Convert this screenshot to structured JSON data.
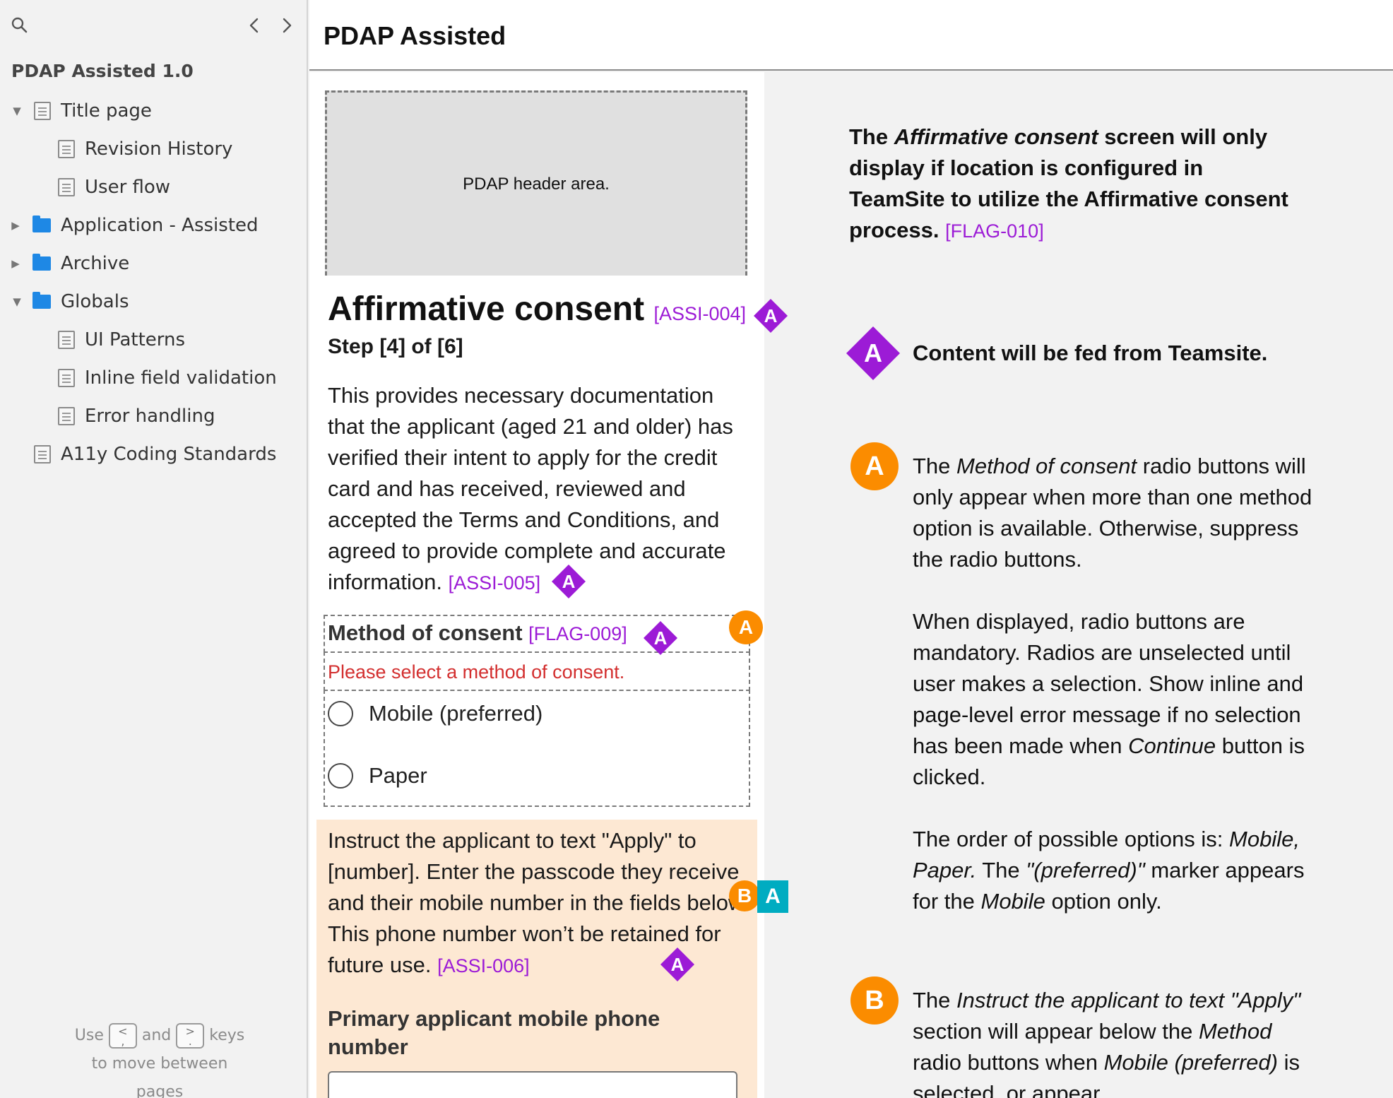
{
  "sidebar": {
    "project_title": "PDAP Assisted 1.0",
    "items": [
      {
        "label": "Title page",
        "type": "doc",
        "level": 0,
        "expanded": true
      },
      {
        "label": "Revision History",
        "type": "doc",
        "level": 1
      },
      {
        "label": "User flow",
        "type": "doc",
        "level": 1
      },
      {
        "label": "Application - Assisted",
        "type": "folder",
        "level": 0,
        "expanded": false
      },
      {
        "label": "Archive",
        "type": "folder",
        "level": 0,
        "expanded": false
      },
      {
        "label": "Globals",
        "type": "folder",
        "level": 0,
        "expanded": true
      },
      {
        "label": "UI Patterns",
        "type": "doc",
        "level": 1
      },
      {
        "label": "Inline field validation",
        "type": "doc",
        "level": 1
      },
      {
        "label": "Error handling",
        "type": "doc",
        "level": 1
      },
      {
        "label": "A11y Coding Standards",
        "type": "doc",
        "level": 0
      }
    ],
    "hint": {
      "use": "Use",
      "key_prev": "<",
      "and": "and",
      "key_next": ">",
      "keys": "keys",
      "line2": "to move between pages"
    }
  },
  "page": {
    "title": "PDAP Assisted"
  },
  "wireframe": {
    "header_area": "PDAP header area.",
    "heading": "Affirmative consent",
    "heading_ref": "[ASSI-004]",
    "step": "Step [4] of [6]",
    "description": "This provides necessary documentation that the applicant (aged 21 and older) has verified their intent to apply for the credit card and has received, reviewed and accepted the Terms and Conditions, and agreed to provide complete and accurate information.",
    "description_ref": "[ASSI-005]",
    "method_label": "Method of consent",
    "method_ref": "[FLAG-009]",
    "error": "Please select a method of consent.",
    "options": [
      "Mobile (preferred)",
      "Paper"
    ],
    "instruct_text": "Instruct the applicant to text \"Apply\" to [number]. Enter the passcode they receive and their mobile number in the fields below. This phone number won’t be retained for future use.",
    "instruct_ref": "[ASSI-006]",
    "phone_label": "Primary applicant mobile phone number"
  },
  "badges": {
    "a": "A",
    "b": "B"
  },
  "notes": {
    "intro_pre": "The ",
    "intro_em": "Affirmative consent",
    "intro_post": " screen will only display if location is configured in TeamSite to utilize the Affirmative consent process.",
    "intro_ref": "[FLAG-010]",
    "diamond_note": "Content will be fed from Teamsite.",
    "a_p1_pre": "The ",
    "a_p1_em": "Method of consent",
    "a_p1_post": " radio buttons will only appear when more than one method option is available. Otherwise, suppress the radio buttons.",
    "a_p2_pre": "When displayed, radio buttons are mandatory. Radios are unselected until user makes a selection. Show inline and page-level error message if no selection has been made when ",
    "a_p2_em": "Continue",
    "a_p2_post": " button is clicked.",
    "a_p3_pre": "The order of possible options is: ",
    "a_p3_em1": "Mobile, Paper.",
    "a_p3_mid": " The ",
    "a_p3_em2": "\"(preferred)\"",
    "a_p3_mid2": " marker appears for the ",
    "a_p3_em3": "Mobile",
    "a_p3_post": " option only.",
    "b_pre": "The ",
    "b_em1": "Instruct the applicant to text \"Apply\"",
    "b_mid": " section will appear below the ",
    "b_em2": "Method",
    "b_mid2": " radio buttons when ",
    "b_em3": "Mobile (preferred)",
    "b_post": " is selected, or appear"
  },
  "colors": {
    "ref_purple": "#9c1bd6",
    "badge_orange": "#fb8c00",
    "badge_teal": "#00acc1",
    "error_red": "#d32f2f",
    "peach_bg": "#fde8d3",
    "folder_blue": "#1e88e5"
  },
  "icons": {
    "search": "search-icon",
    "prev": "chevron-left-icon",
    "next": "chevron-right-icon",
    "doc": "document-icon",
    "folder": "folder-icon"
  }
}
